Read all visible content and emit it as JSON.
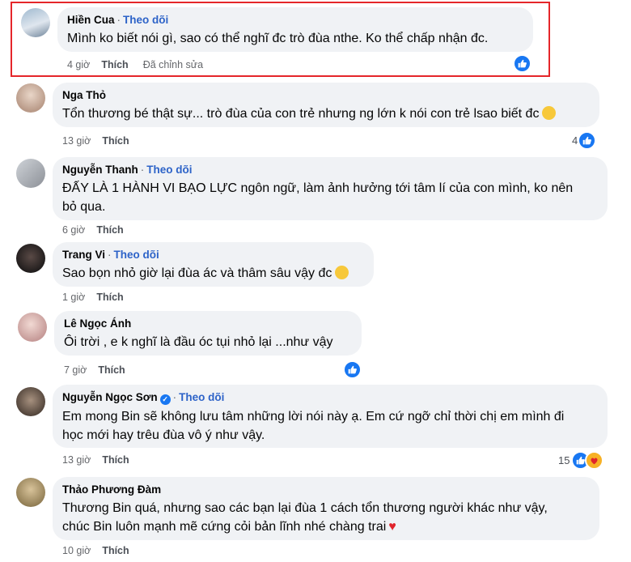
{
  "comments": [
    {
      "name": "Hiền Cua",
      "follow": "Theo dõi",
      "lines": [
        "Mình ko biết nói gì, sao có thể nghĩ đc trò đùa nthe. Ko thể chấp nhận đc."
      ],
      "time": "4 giờ",
      "like": "Thích",
      "edited": "Đã chỉnh sửa",
      "reaction_count": ""
    },
    {
      "name": "Nga Thỏ",
      "follow": "",
      "lines": [
        "Tổn thương bé thật sự... trò đùa của con trẻ nhưng ng lớn k nói con trẻ lsao biết đc"
      ],
      "time": "13 giờ",
      "like": "Thích",
      "reaction_count": "4"
    },
    {
      "name": "Nguyễn Thanh",
      "follow": "Theo dõi",
      "lines": [
        "ĐẤY LÀ 1 HÀNH VI BẠO LỰC ngôn ngữ, làm ảnh hưởng tới tâm lí của con mình, ko nên",
        "bỏ qua."
      ],
      "time": "6 giờ",
      "like": "Thích",
      "reaction_count": ""
    },
    {
      "name": "Trang Vi",
      "follow": "Theo dõi",
      "lines": [
        "Sao bọn nhỏ giờ lại đùa ác và thâm sâu vậy đc"
      ],
      "time": "1 giờ",
      "like": "Thích",
      "reaction_count": ""
    },
    {
      "name": "Lê Ngọc Ánh",
      "follow": "",
      "lines": [
        "Ôi trời , e k nghĩ là đầu óc tụi nhỏ lại ...như vậy"
      ],
      "time": "7 giờ",
      "like": "Thích",
      "reaction_count": ""
    },
    {
      "name": "Nguyễn Ngọc Sơn",
      "follow": "Theo dõi",
      "lines": [
        "Em mong Bin sẽ không lưu tâm những lời nói này ạ. Em cứ ngỡ chỉ thời chị em mình đi",
        "học mới hay trêu đùa vô ý như vậy."
      ],
      "time": "13 giờ",
      "like": "Thích",
      "reaction_count": "15"
    },
    {
      "name": "Thảo Phương Đàm",
      "follow": "",
      "lines": [
        "Thương Bin quá, nhưng sao các bạn lại đùa 1 cách tổn thương người khác như vậy,",
        "chúc Bin luôn mạnh mẽ cứng cỏi bản lĩnh nhé chàng trai"
      ],
      "time": "10 giờ",
      "like": "Thích",
      "reaction_count": ""
    }
  ],
  "colors": {
    "highlight": "#e5262a",
    "link": "#2d63c8",
    "bubble": "#f0f2f5",
    "like": "#1877f2"
  }
}
